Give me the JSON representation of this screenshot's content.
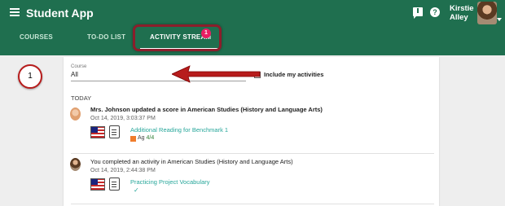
{
  "header": {
    "app_title": "Student App",
    "user_name": "Kirstie Alley",
    "icons": [
      "menu-icon",
      "message-alert-icon",
      "help-icon",
      "avatar",
      "chevron-down-icon"
    ]
  },
  "tabs": [
    {
      "label": "COURSES"
    },
    {
      "label": "TO-DO LIST"
    },
    {
      "label": "ACTIVITY STREAM",
      "badge": "1",
      "active": true
    }
  ],
  "step_marker": "1",
  "filter": {
    "course_label": "Course",
    "course_value": "All",
    "include_label": "Include my activities"
  },
  "section_heading": "TODAY",
  "activities": [
    {
      "title": "Mrs. Johnson updated a score in American Studies (History and Language Arts)",
      "time": "Oct 14, 2019, 3:03:37 PM",
      "link": "Additional Reading for Benchmark 1",
      "grade_label": "Ag",
      "grade_value": "4/4"
    },
    {
      "title": "You completed an activity in American Studies (History and Language Arts)",
      "time": "Oct 14, 2019, 2:44:38 PM",
      "link": "Practicing Project Vocabulary",
      "status_icon": "check-icon"
    }
  ],
  "colors": {
    "header": "#1f6f4f",
    "badge": "#e91e63",
    "highlight": "#8b1e2b",
    "link": "#26a69a",
    "arrow": "#b71c1c"
  }
}
